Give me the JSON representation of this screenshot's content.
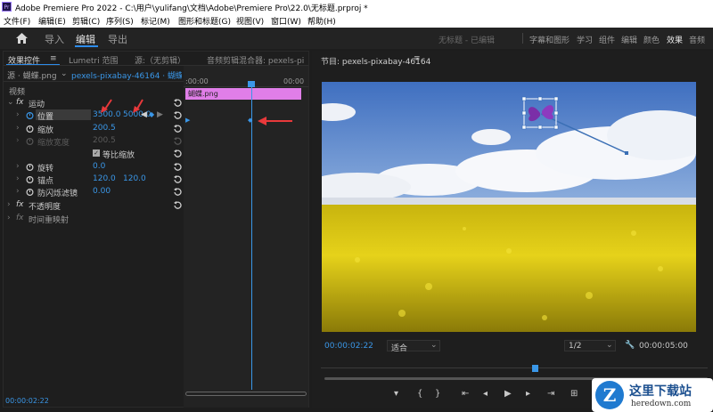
{
  "titlebar": {
    "app_icon": "Pr",
    "title": "Adobe Premiere Pro 2022 - C:\\用户\\yulifang\\文档\\Adobe\\Premiere Pro\\22.0\\无标题.prproj *"
  },
  "menu": [
    "文件(F)",
    "编辑(E)",
    "剪辑(C)",
    "序列(S)",
    "标记(M)",
    "图形和标题(G)",
    "视图(V)",
    "窗口(W)",
    "帮助(H)"
  ],
  "workspace": {
    "tabs": [
      "导入",
      "编辑",
      "导出"
    ],
    "active_tab": "编辑",
    "project_title": "无标题 - 已编辑",
    "right_tabs": [
      "字幕和图形",
      "学习",
      "组件",
      "编辑",
      "颜色",
      "效果",
      "音频"
    ],
    "active_right": "效果"
  },
  "effect_controls": {
    "tabs": [
      "效果控件",
      "Lumetri 范围",
      "源:（无剪辑）",
      "音频剪辑混合器: pexels-pi"
    ],
    "source_label": "源 · 蝴蝶.png",
    "sequence_label": "pexels-pixabay-46164 · 蝴蝶...",
    "video_header": "视频",
    "motion": "运动",
    "position_label": "位置",
    "position_x": "3500.0",
    "position_y": "5000.0",
    "scale_label": "缩放",
    "scale_value": "200.5",
    "scale_width_label": "缩放宽度",
    "scale_width_value": "200.5",
    "uniform_scale_label": "等比缩放",
    "rotation_label": "旋转",
    "rotation_value": "0.0",
    "anchor_label": "锚点",
    "anchor_x": "120.0",
    "anchor_y": "120.0",
    "antiflicker_label": "防闪烁滤镜",
    "antiflicker_value": "0.00",
    "opacity_label": "不透明度",
    "time_remap_label": "时间重映射",
    "fx_label": "fx",
    "timecode": "00:00:02:22"
  },
  "mini_timeline": {
    "ruler_start": ":00:00",
    "ruler_end": "00:00",
    "clip_name": "蝴蝶.png"
  },
  "program_monitor": {
    "title": "节目: pexels-pixabay-46164",
    "timecode": "00:00:02:22",
    "fit": "适合",
    "resolution": "1/2",
    "duration": "00:00:05:00"
  },
  "watermark": {
    "brand": "这里下载站",
    "url": "heredown.com",
    "logo": "Z"
  },
  "colors": {
    "accent": "#2d8ceb",
    "timecode": "#3a97e8",
    "clip": "#e07ee8",
    "arrow": "#e8393b"
  }
}
